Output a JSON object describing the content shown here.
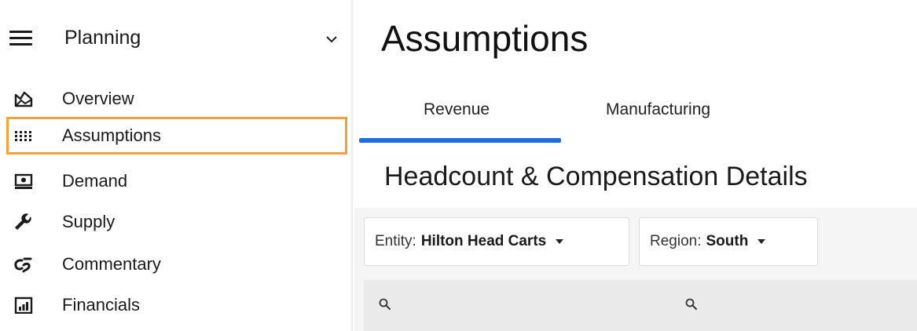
{
  "sidebar": {
    "title": "Planning",
    "items": [
      {
        "label": "Overview",
        "icon": "overview-mountain-icon"
      },
      {
        "label": "Assumptions",
        "icon": "grid-dots-icon",
        "active": true
      },
      {
        "label": "Demand",
        "icon": "demand-monitor-icon"
      },
      {
        "label": "Supply",
        "icon": "wrench-icon"
      },
      {
        "label": "Commentary",
        "icon": "commentary-icon"
      },
      {
        "label": "Financials",
        "icon": "bar-chart-icon"
      }
    ]
  },
  "main": {
    "title": "Assumptions",
    "tabs": [
      {
        "label": "Revenue",
        "active": true
      },
      {
        "label": "Manufacturing",
        "active": false
      }
    ],
    "section_title": "Headcount & Compensation Details",
    "filters": [
      {
        "key": "Entity:",
        "value": "Hilton Head Carts"
      },
      {
        "key": "Region:",
        "value": "South"
      }
    ]
  },
  "colors": {
    "active_border": "#f0a23a",
    "tab_underline": "#1f6fe0"
  }
}
